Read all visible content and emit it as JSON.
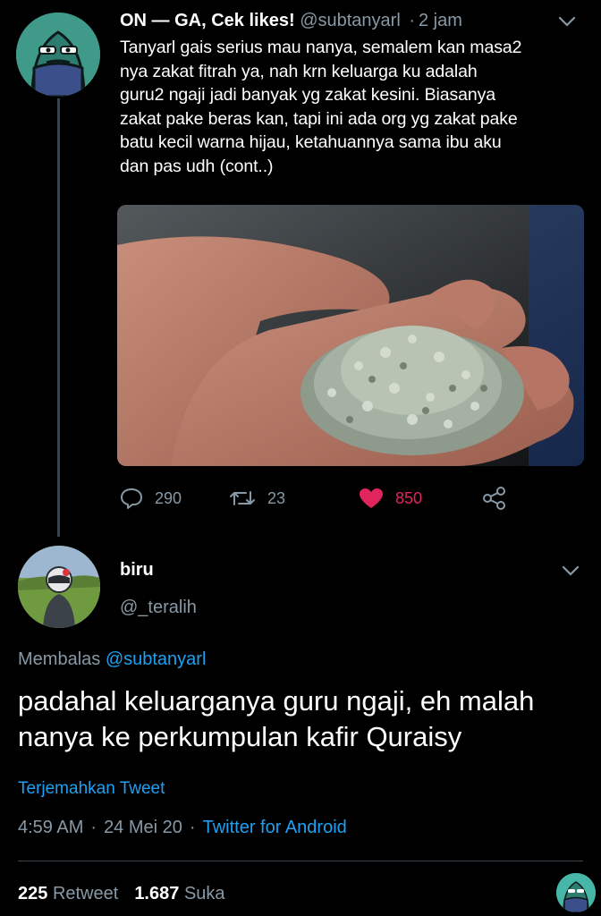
{
  "tweet1": {
    "display_name": "ON — GA, Cek likes!",
    "handle": "@subtanyarl",
    "separator": "·",
    "time": "2 jam",
    "text_lines": [
      "Tanyarl gais serius mau nanya, semalem kan masa2",
      "nya zakat fitrah ya, nah krn keluarga ku adalah",
      "guru2 ngaji jadi banyak yg zakat kesini. Biasanya",
      "zakat pake beras kan, tapi ini ada org yg zakat pake",
      "batu kecil warna hijau, ketahuannya sama ibu aku",
      "dan pas udh  (cont..)"
    ],
    "replies": "290",
    "retweets": "23",
    "likes": "850",
    "like_color": "#e0245e"
  },
  "tweet2": {
    "display_name": "biru",
    "handle": "@_teralih",
    "reply_prefix": "Membalas",
    "reply_mention": "@subtanyarl",
    "text_lines": [
      "padahal keluarganya guru ngaji, eh malah",
      "nanya ke perkumpulan kafir Quraisy"
    ],
    "translate_label": "Terjemahkan Tweet",
    "time": "4:59 AM",
    "date": "24 Mei 20",
    "separator": "·",
    "source": "Twitter for Android",
    "retweet_count": "225",
    "retweet_label": "Retweet",
    "like_count": "1.687",
    "like_label": "Suka"
  },
  "colors": {
    "background": "#000000",
    "secondary_text": "#8899a6",
    "link": "#1da1f2",
    "divider": "#38444d"
  },
  "icons": [
    "chevron-down-icon",
    "reply-icon",
    "retweet-icon",
    "heart-icon",
    "share-icon"
  ]
}
